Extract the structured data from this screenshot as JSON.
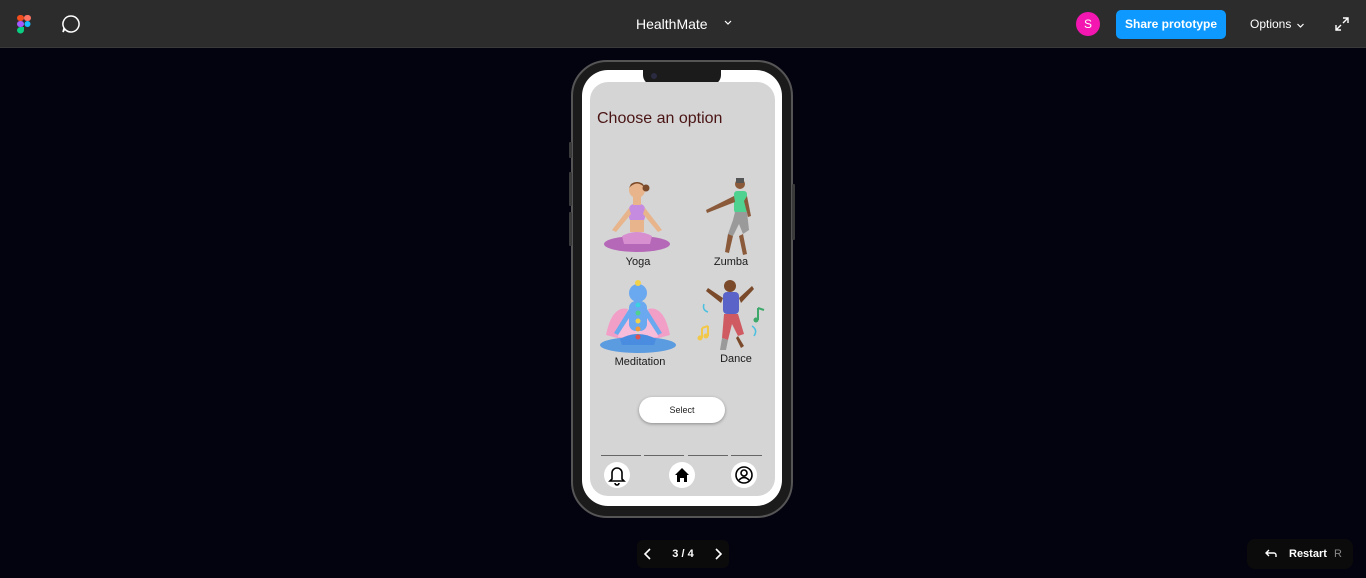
{
  "toolbar": {
    "file_title": "HealthMate",
    "avatar_initial": "S",
    "share_label": "Share prototype",
    "options_label": "Options",
    "icons": [
      "figma-logo",
      "comment-icon",
      "chevron-down-icon",
      "expand-icon"
    ]
  },
  "screen": {
    "heading": "Choose an option",
    "options": [
      {
        "label": "Yoga",
        "figure": "yoga-figure"
      },
      {
        "label": "Zumba",
        "figure": "zumba-figure"
      },
      {
        "label": "Meditation",
        "figure": "meditation-figure"
      },
      {
        "label": "Dance",
        "figure": "dance-figure"
      }
    ],
    "select_label": "Select",
    "nav": [
      {
        "name": "notifications",
        "icon": "bell-icon"
      },
      {
        "name": "home",
        "icon": "home-icon"
      },
      {
        "name": "profile",
        "icon": "user-circle-icon"
      }
    ]
  },
  "pager": {
    "count": "3 / 4"
  },
  "restart": {
    "label": "Restart",
    "shortcut": "R"
  },
  "colors": {
    "canvas": "#03020f",
    "toolbar": "#2c2c2c",
    "share": "#0d99ff",
    "avatar": "#f316b0",
    "app_bg": "#d5d5d5",
    "heading": "#4a1414"
  }
}
